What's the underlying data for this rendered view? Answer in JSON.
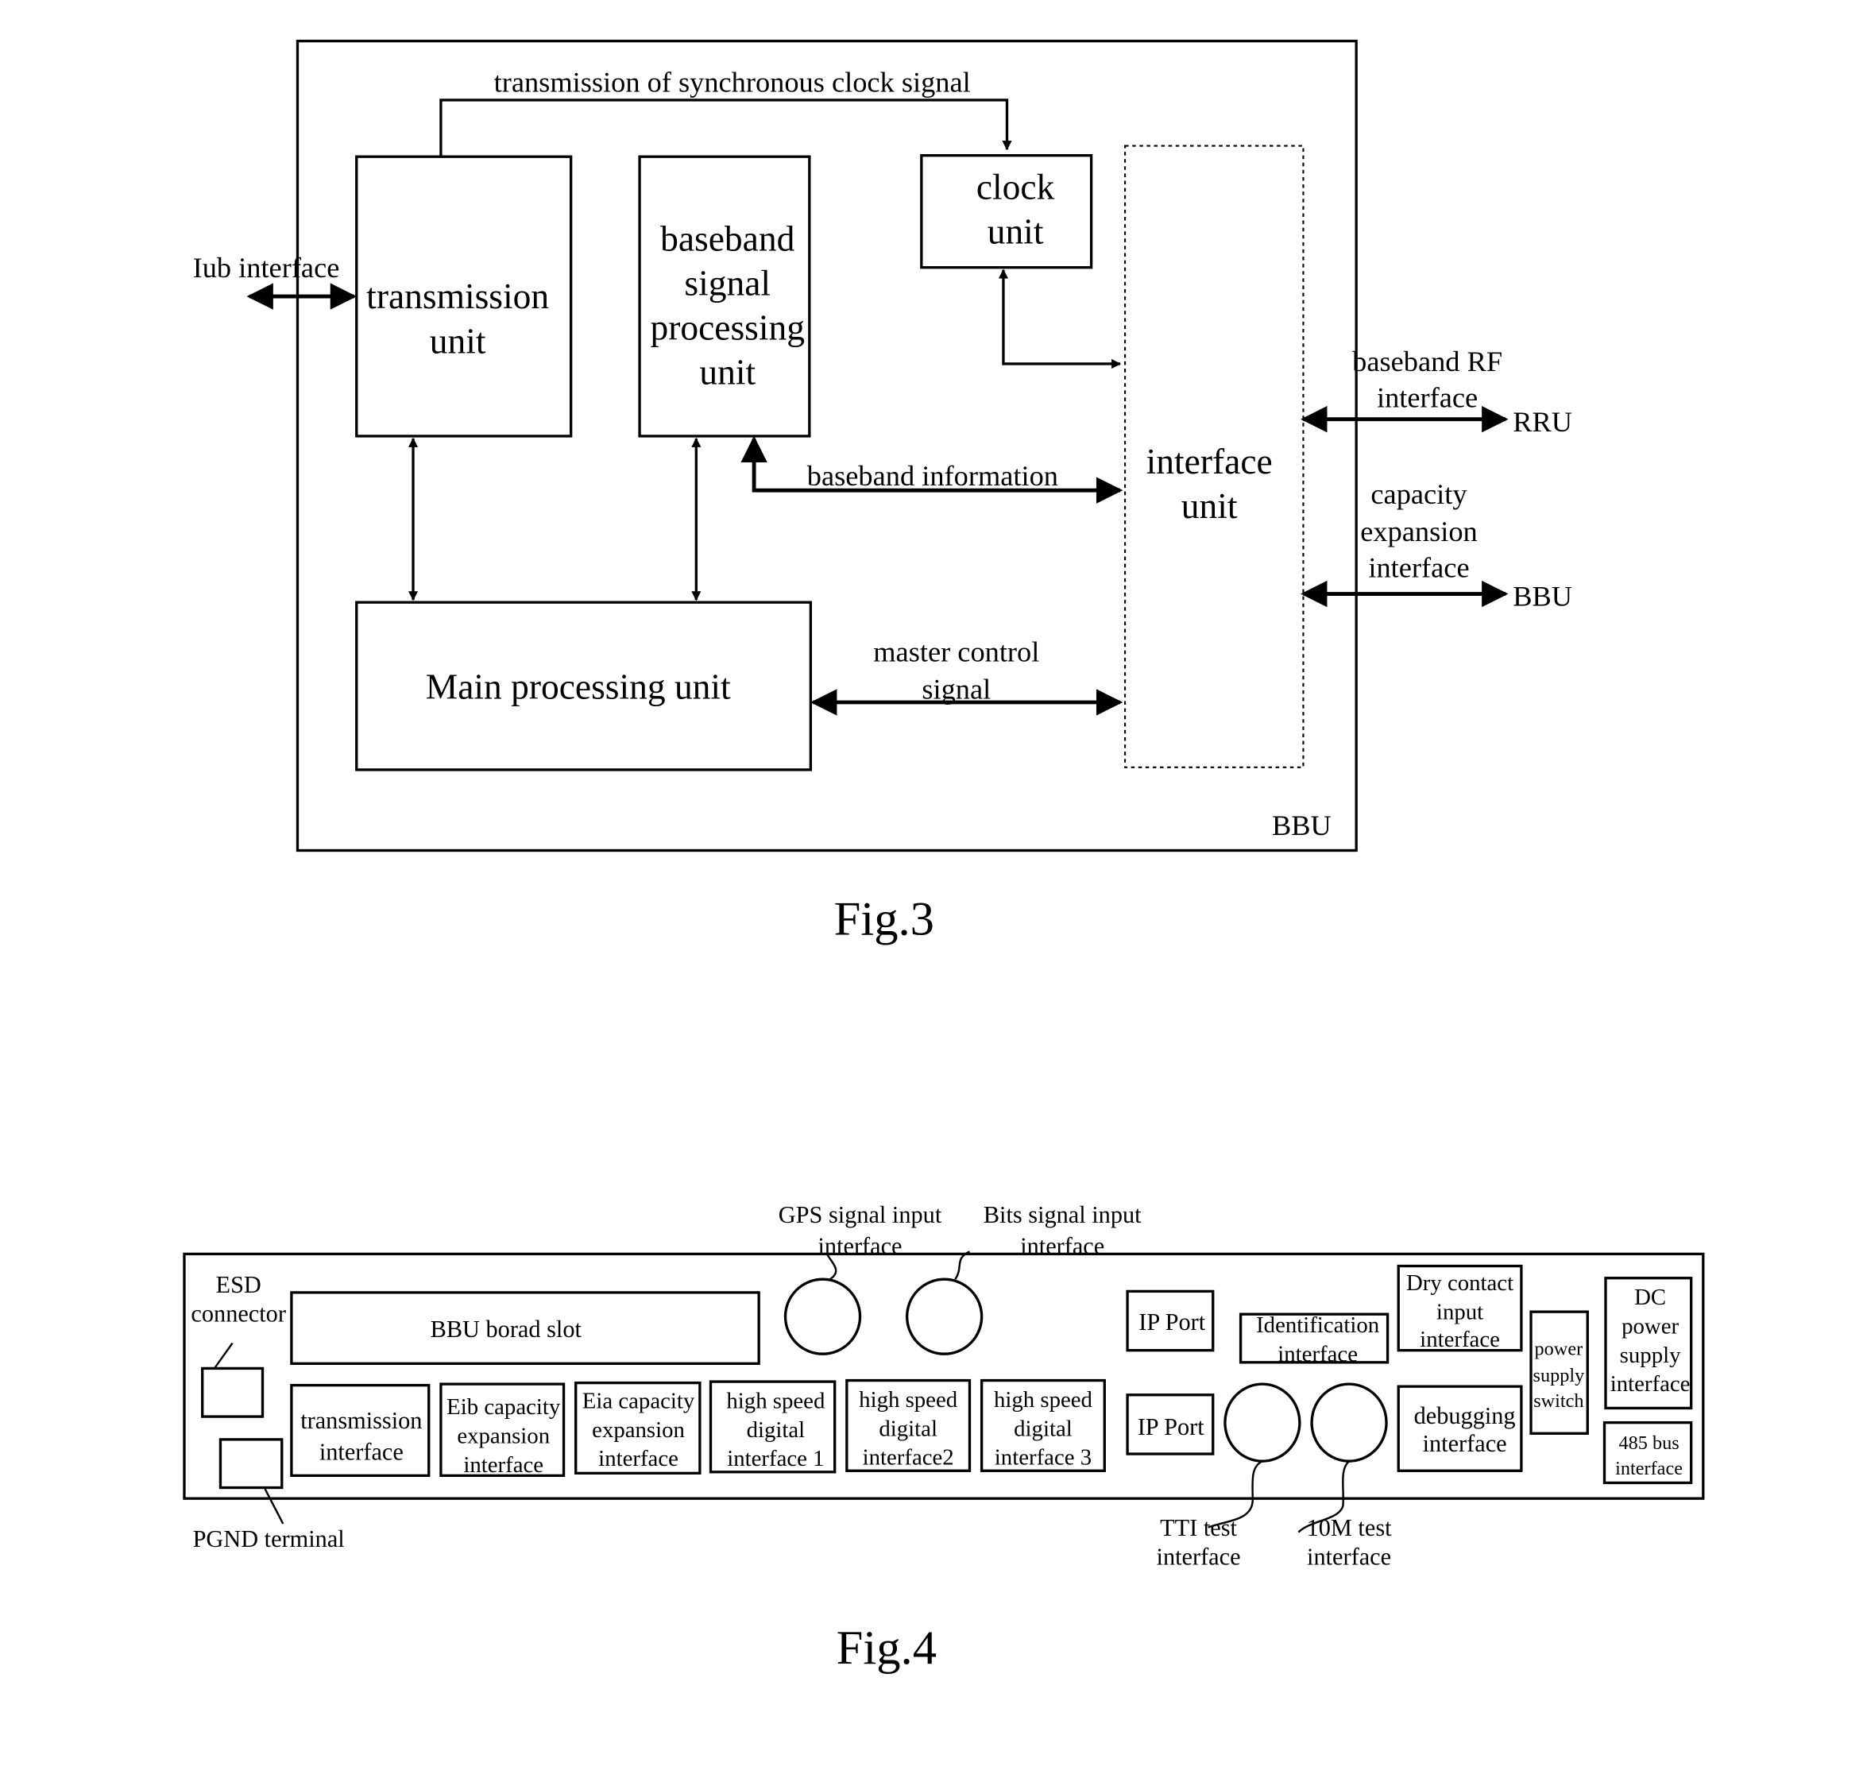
{
  "fig3": {
    "caption": "Fig.3",
    "container_label": "BBU",
    "top_label": "transmission of synchronous clock signal",
    "units": {
      "transmission": [
        "transmission",
        "unit"
      ],
      "baseband": [
        "baseband",
        "signal",
        "processing",
        "unit"
      ],
      "clock": [
        "clock",
        "unit"
      ],
      "interface": [
        "interface",
        "unit"
      ],
      "main": "Main processing unit"
    },
    "labels": {
      "iub": "Iub interface",
      "baseband_info": "baseband information",
      "master_control": [
        "master control",
        "signal"
      ],
      "baseband_rf": [
        "baseband RF",
        "interface"
      ],
      "capacity_expansion": [
        "capacity",
        "expansion",
        "interface"
      ],
      "rru": "RRU",
      "bbu_ext": "BBU"
    }
  },
  "fig4": {
    "caption": "Fig.4",
    "esd": [
      "ESD",
      "connector"
    ],
    "pgnd": "PGND terminal",
    "slot": "BBU borad slot",
    "gps": [
      "GPS signal input",
      "interface"
    ],
    "bits": [
      "Bits signal input",
      "interface"
    ],
    "bottom_row": [
      [
        "transmission",
        "interface"
      ],
      [
        "Eib capacity",
        "expansion",
        "interface"
      ],
      [
        "Eia capacity",
        "expansion",
        "interface"
      ],
      [
        "high speed",
        "digital",
        "interface 1"
      ],
      [
        "high speed",
        "digital",
        "interface2"
      ],
      [
        "high speed",
        "digital",
        "interface 3"
      ]
    ],
    "ip_port_top": "IP Port",
    "ip_port_bottom": "IP Port",
    "identification": [
      "Identification",
      "interface"
    ],
    "dry_contact": [
      "Dry contact",
      "input",
      "interface"
    ],
    "debugging": [
      "debugging",
      "interface"
    ],
    "power_switch": [
      "power",
      "supply",
      "switch"
    ],
    "dc_power": [
      "DC",
      "power",
      "supply",
      "interface"
    ],
    "bus485": [
      "485 bus",
      "interface"
    ],
    "tti": [
      "TTI test",
      "interface"
    ],
    "tenm": [
      "10M test",
      "interface"
    ]
  }
}
